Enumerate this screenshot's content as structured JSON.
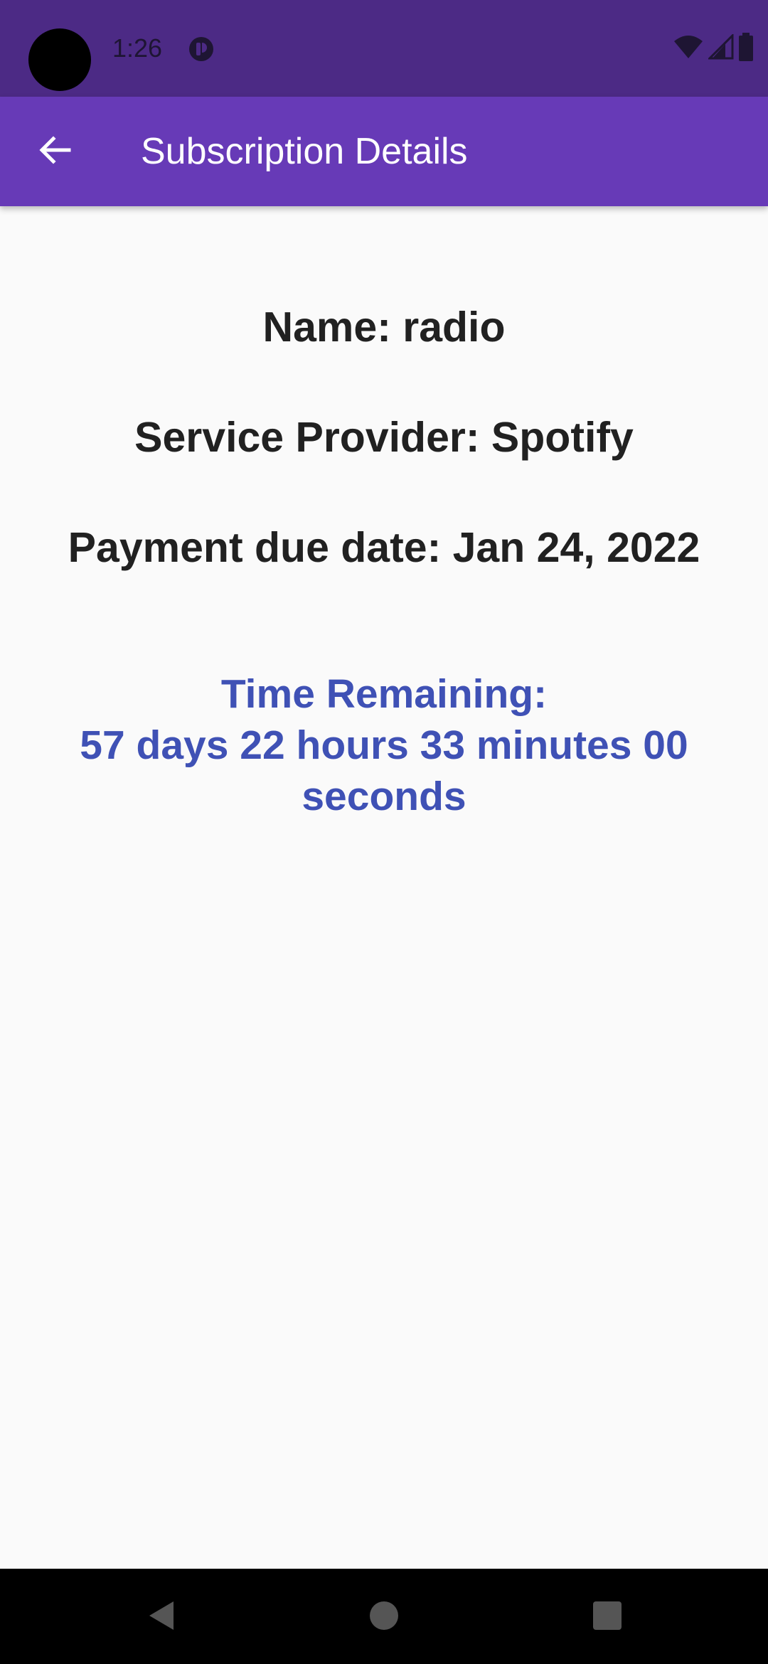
{
  "status_bar": {
    "time": "1:26",
    "icons": [
      "app-notification-icon",
      "wifi-icon",
      "cell-signal-icon",
      "battery-icon"
    ]
  },
  "app_bar": {
    "title": "Subscription Details",
    "back_icon": "arrow-back-icon"
  },
  "details": {
    "name": "Name: radio",
    "provider": "Service Provider: Spotify",
    "due_date": "Payment due date: Jan 24, 2022"
  },
  "countdown": {
    "heading": "Time Remaining:",
    "value": "57 days 22 hours 33 minutes 00 seconds"
  },
  "nav_bar": {
    "icons": [
      "back-triangle-icon",
      "home-circle-icon",
      "recents-square-icon"
    ]
  },
  "colors": {
    "status_bar": "#4c2a85",
    "app_bar": "#673ab7",
    "countdown_text": "#3f51b5",
    "body_text": "#212121",
    "background": "#fafafa"
  }
}
